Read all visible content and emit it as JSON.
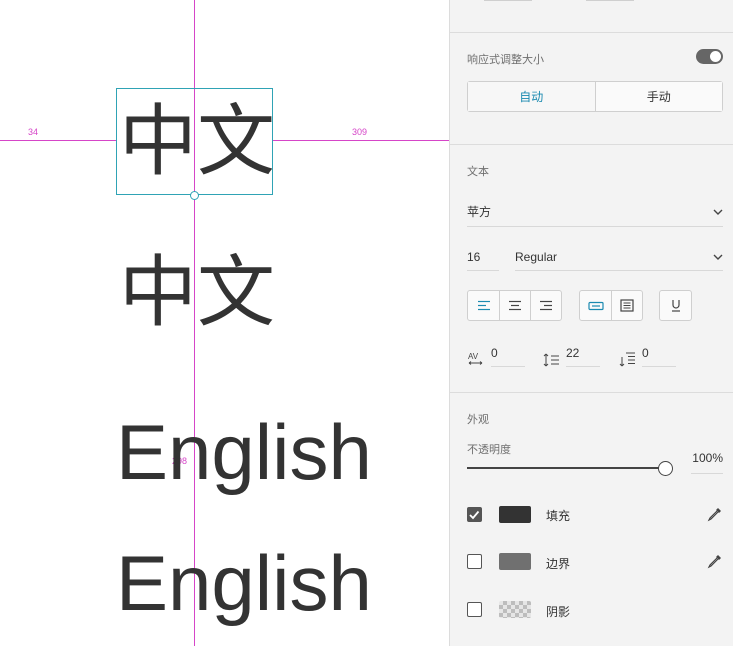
{
  "canvas": {
    "guides": {
      "left_label": "34",
      "right_label": "309",
      "bottom_label": "298"
    },
    "samples": [
      "中文",
      "中文",
      "English",
      "English"
    ]
  },
  "panel": {
    "responsive": {
      "label": "响应式调整大小",
      "enabled": true,
      "auto_label": "自动",
      "manual_label": "手动",
      "selected": "自动"
    },
    "text": {
      "section_label": "文本",
      "font_family": "苹方",
      "font_size": "16",
      "font_weight": "Regular",
      "align_icons": [
        "align-left-icon",
        "align-center-icon",
        "align-right-icon"
      ],
      "box_icons": [
        "auto-width-text-icon",
        "fixed-size-text-icon"
      ],
      "underline_icon": "underline-icon",
      "char_spacing": "0",
      "line_spacing": "22",
      "paragraph_spacing": "0"
    },
    "appearance": {
      "section_label": "外观",
      "opacity_label": "不透明度",
      "opacity_value": "100%",
      "opacity_level": 1.0,
      "fill": {
        "checked": true,
        "label": "填充",
        "color": "#333333"
      },
      "border": {
        "checked": false,
        "label": "边界",
        "color": "#707070"
      },
      "shadow": {
        "checked": false,
        "label": "阴影"
      }
    },
    "colors": {
      "accent": "#1b8ab0",
      "selection": "#2fa3b5",
      "guide": "#d645c8"
    }
  }
}
